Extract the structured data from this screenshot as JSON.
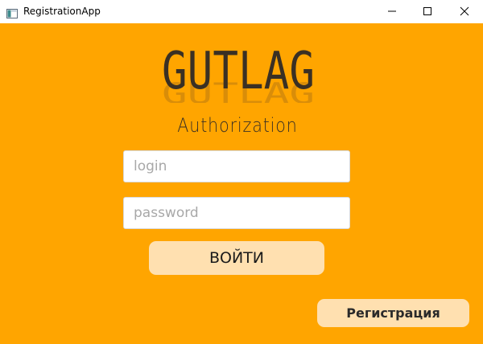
{
  "window": {
    "title": "RegistrationApp",
    "minimize_glyph": "—",
    "maximize_glyph": "☐",
    "close_glyph": "✕"
  },
  "brand": {
    "logo_text": "GUTLAG"
  },
  "auth": {
    "heading": "Authorization",
    "login_placeholder": "login",
    "login_value": "",
    "password_placeholder": "password",
    "password_value": "",
    "submit_label": "ВОЙТИ",
    "register_label": "Регистрация"
  },
  "colors": {
    "background": "#ffa500",
    "button": "#ffe0b0",
    "logo": "#3a3024"
  },
  "icons": {
    "app": "window-app-icon",
    "minimize": "minimize-icon",
    "maximize": "maximize-icon",
    "close": "close-icon"
  }
}
